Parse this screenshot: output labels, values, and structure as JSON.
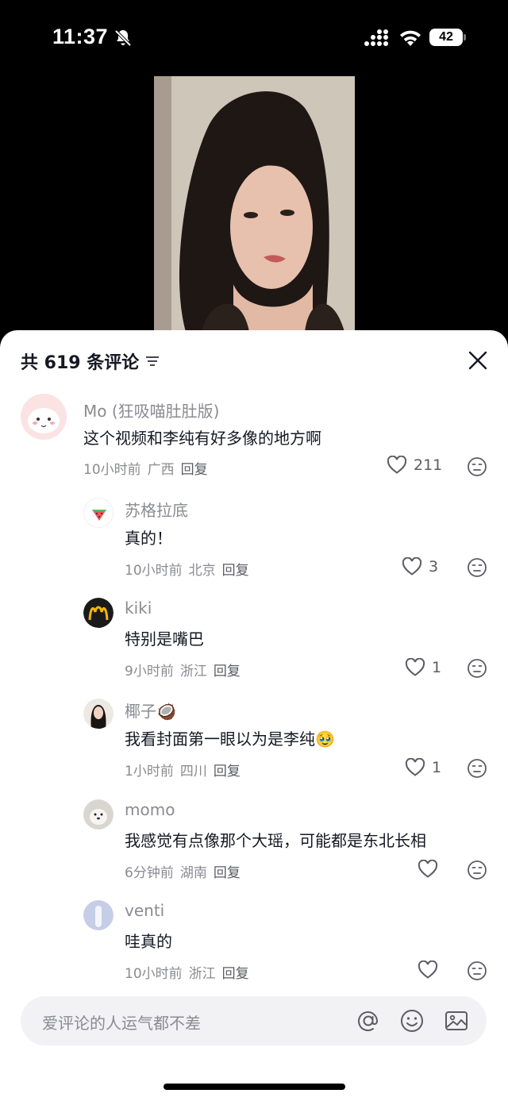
{
  "status": {
    "time": "11:37",
    "battery": "42"
  },
  "header": {
    "comment_count": "共 619 条评论"
  },
  "comments": [
    {
      "name": "Mo (狂吸喵肚肚版)",
      "text": "这个视频和李纯有好多像的地方啊",
      "time": "10小时前",
      "location": "广西",
      "reply": "回复",
      "likes": "211"
    },
    {
      "name": "苏格拉底",
      "text": "真的！",
      "time": "10小时前",
      "location": "北京",
      "reply": "回复",
      "likes": "3"
    },
    {
      "name": "kiki",
      "text": "特别是嘴巴",
      "time": "9小时前",
      "location": "浙江",
      "reply": "回复",
      "likes": "1"
    },
    {
      "name": "椰子",
      "name_emoji": "🥥",
      "text": "我看封面第一眼以为是李纯",
      "text_emoji": "🥹",
      "time": "1小时前",
      "location": "四川",
      "reply": "回复",
      "likes": "1"
    },
    {
      "name": "momo",
      "text": "我感觉有点像那个大瑶，可能都是东北长相",
      "time": "6分钟前",
      "location": "湖南",
      "reply": "回复",
      "likes": ""
    },
    {
      "name": "venti",
      "text": "哇真的",
      "time": "10小时前",
      "location": "浙江",
      "reply": "回复",
      "likes": ""
    }
  ],
  "input": {
    "placeholder": "爱评论的人运气都不差"
  },
  "colors": {
    "text": "#161823",
    "muted": "#8a8b91",
    "sheet": "#ffffff",
    "input_bg": "#f2f2f4"
  },
  "icons": [
    "bell-off-icon",
    "signal-icon",
    "wifi-icon",
    "battery-icon",
    "sort-icon",
    "close-icon",
    "heart-icon",
    "meh-emoji-icon",
    "at-icon",
    "emoji-icon",
    "image-icon"
  ]
}
